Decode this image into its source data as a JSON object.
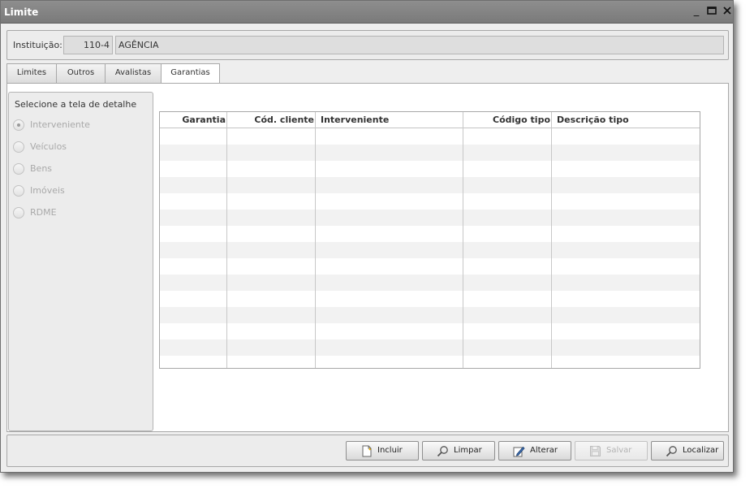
{
  "window": {
    "title": "Limite"
  },
  "institution": {
    "label": "Instituição:",
    "code": "110-4",
    "name": "AGÊNCIA"
  },
  "tabs": [
    {
      "label": "Limites",
      "active": false
    },
    {
      "label": "Outros",
      "active": false
    },
    {
      "label": "Avalistas",
      "active": false
    },
    {
      "label": "Garantias",
      "active": true
    }
  ],
  "detail_selector": {
    "title": "Selecione a tela de detalhe",
    "options": [
      {
        "label": "Interveniente",
        "selected": true
      },
      {
        "label": "Veículos",
        "selected": false
      },
      {
        "label": "Bens",
        "selected": false
      },
      {
        "label": "Imóveis",
        "selected": false
      },
      {
        "label": "RDME",
        "selected": false
      }
    ]
  },
  "table": {
    "columns": [
      "Garantia",
      "Cód. cliente",
      "Interveniente",
      "Código tipo",
      "Descrição tipo"
    ],
    "rows": []
  },
  "buttons": [
    {
      "label": "Incluir",
      "icon": "new-document-icon",
      "enabled": true
    },
    {
      "label": "Limpar",
      "icon": "magnifier-icon",
      "enabled": true
    },
    {
      "label": "Alterar",
      "icon": "edit-pen-icon",
      "enabled": true
    },
    {
      "label": "Salvar",
      "icon": "floppy-disk-icon",
      "enabled": false
    },
    {
      "label": "Localizar",
      "icon": "magnifier-icon",
      "enabled": true
    }
  ]
}
